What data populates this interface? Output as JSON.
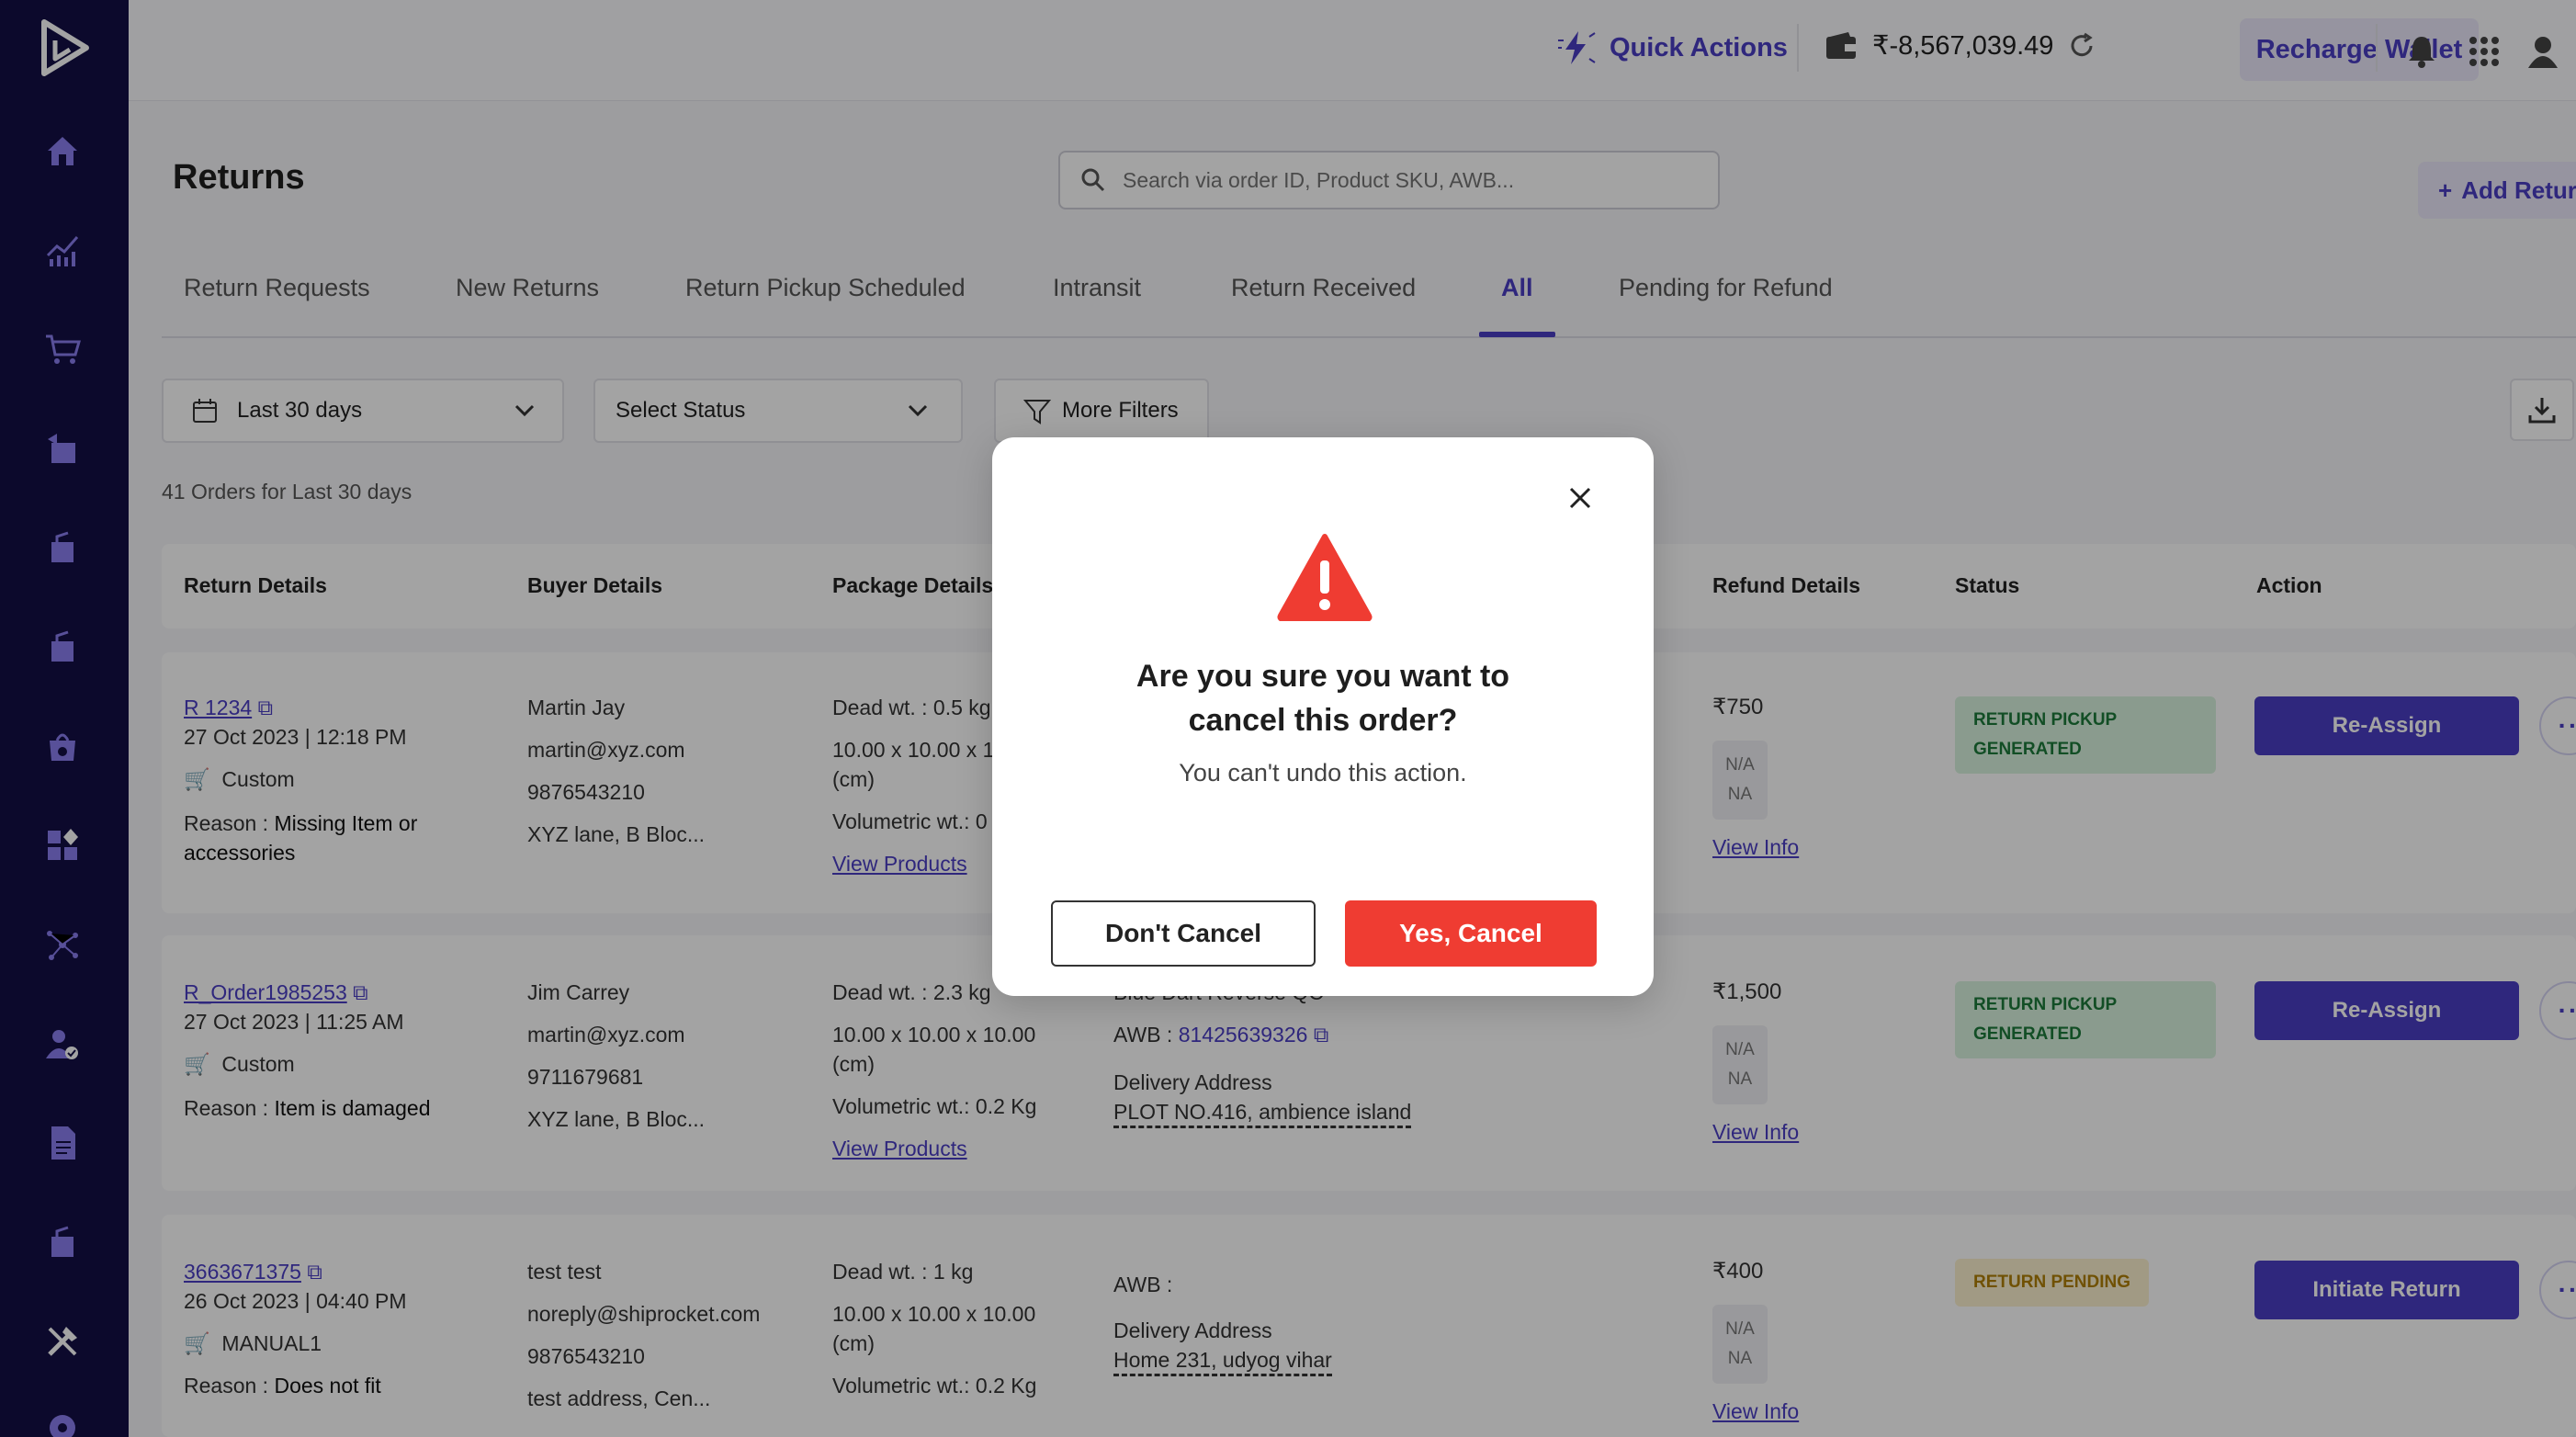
{
  "header": {
    "quick_actions": "Quick Actions",
    "wallet_balance": "₹-8,567,039.49",
    "recharge_label": "Recharge Wallet"
  },
  "page": {
    "title": "Returns",
    "search_placeholder": "Search via order ID, Product SKU, AWB...",
    "add_return": "Add Return",
    "tabs": [
      "Return Requests",
      "New Returns",
      "Return Pickup Scheduled",
      "Intransit",
      "Return Received",
      "All",
      "Pending for Refund"
    ],
    "active_tab": "All",
    "filters": {
      "date": "Last 30 days",
      "status": "Select Status",
      "more": "More Filters"
    },
    "count": "41 Orders for Last 30 days"
  },
  "table": {
    "headers": [
      "Return Details",
      "Buyer Details",
      "Package Details",
      "Refund Details",
      "Status",
      "Action"
    ],
    "rows": [
      {
        "order_id": "R 1234",
        "date": "27 Oct 2023 | 12:18 PM",
        "channel": "Custom",
        "reason_label": "Reason : ",
        "reason": "Missing Item or accessories",
        "buyer_name": "Martin Jay",
        "buyer_email": "martin@xyz.com",
        "buyer_phone": "9876543210",
        "buyer_address": "XYZ lane, B Bloc...",
        "dead_wt": "Dead wt. : 0.5 kg",
        "dims": "10.00 x 10.00 x 1",
        "dims_unit": "(cm)",
        "vol_wt": "Volumetric wt.:  0",
        "view_products": "View Products",
        "refund": "₹750",
        "na1": "N/A",
        "na2": "NA",
        "view_info": "View Info",
        "status": "RETURN PICKUP GENERATED",
        "action": "Re-Assign"
      },
      {
        "order_id": "R_Order1985253",
        "date": "27 Oct 2023 | 11:25 AM",
        "channel": "Custom",
        "reason_label": "Reason : ",
        "reason": "Item is damaged",
        "buyer_name": "Jim Carrey",
        "buyer_email": "martin@xyz.com",
        "buyer_phone": "9711679681",
        "buyer_address": "XYZ lane, B Bloc...",
        "dead_wt": "Dead wt. : 2.3 kg",
        "dims": "10.00 x 10.00 x 10.00",
        "dims_unit": "(cm)",
        "vol_wt": "Volumetric wt.:  0.2 Kg",
        "view_products": "View Products",
        "courier": "Blue Dart Reverse QC",
        "awb_label": "AWB : ",
        "awb": "81425639326",
        "delivery_label": "Delivery Address",
        "delivery_address": "PLOT NO.416, ambience island",
        "refund": "₹1,500",
        "na1": "N/A",
        "na2": "NA",
        "view_info": "View Info",
        "status": "RETURN PICKUP GENERATED",
        "action": "Re-Assign"
      },
      {
        "order_id": "3663671375",
        "date": "26 Oct 2023 | 04:40 PM",
        "channel": "MANUAL1",
        "reason_label": "Reason : ",
        "reason": "Does not fit",
        "buyer_name": "test test",
        "buyer_email": "noreply@shiprocket.com",
        "buyer_phone": "9876543210",
        "buyer_address": "test address, Cen...",
        "dead_wt": "Dead wt. : 1 kg",
        "dims": "10.00 x 10.00 x 10.00",
        "dims_unit": "(cm)",
        "vol_wt": "Volumetric wt.:  0.2 Kg",
        "awb_label": "AWB : ",
        "delivery_label": "Delivery Address",
        "delivery_address": "Home 231, udyog vihar",
        "refund": "₹400",
        "na1": "N/A",
        "na2": "NA",
        "view_info": "View Info",
        "status": "RETURN PENDING",
        "action": "Initiate Return"
      }
    ]
  },
  "modal": {
    "title": "Are you sure you want to cancel this order?",
    "subtitle": "You can't undo this action.",
    "dont_cancel": "Don't Cancel",
    "yes_cancel": "Yes, Cancel"
  },
  "colors": {
    "sidebar": "#130f46",
    "accent": "#4a3dc4",
    "danger": "#ef3c32"
  }
}
